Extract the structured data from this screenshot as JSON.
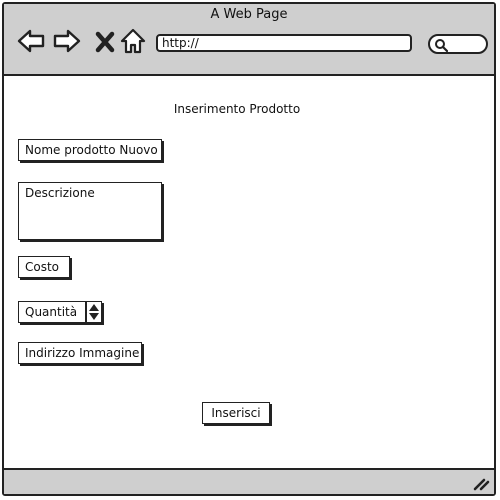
{
  "browser": {
    "title": "A Web Page",
    "url": "http://",
    "nav_icons": [
      "back-arrow-icon",
      "forward-arrow-icon",
      "close-x-icon",
      "home-icon"
    ],
    "search_icon": "search-icon"
  },
  "form": {
    "title": "Inserimento Prodotto",
    "nome_prodotto": "Nome prodotto Nuovo",
    "descrizione": "Descrizione",
    "costo": "Costo",
    "quantita": "Quantità",
    "indirizzo_immagine": "Indirizzo Immagine",
    "submit_label": "Inserisci"
  }
}
